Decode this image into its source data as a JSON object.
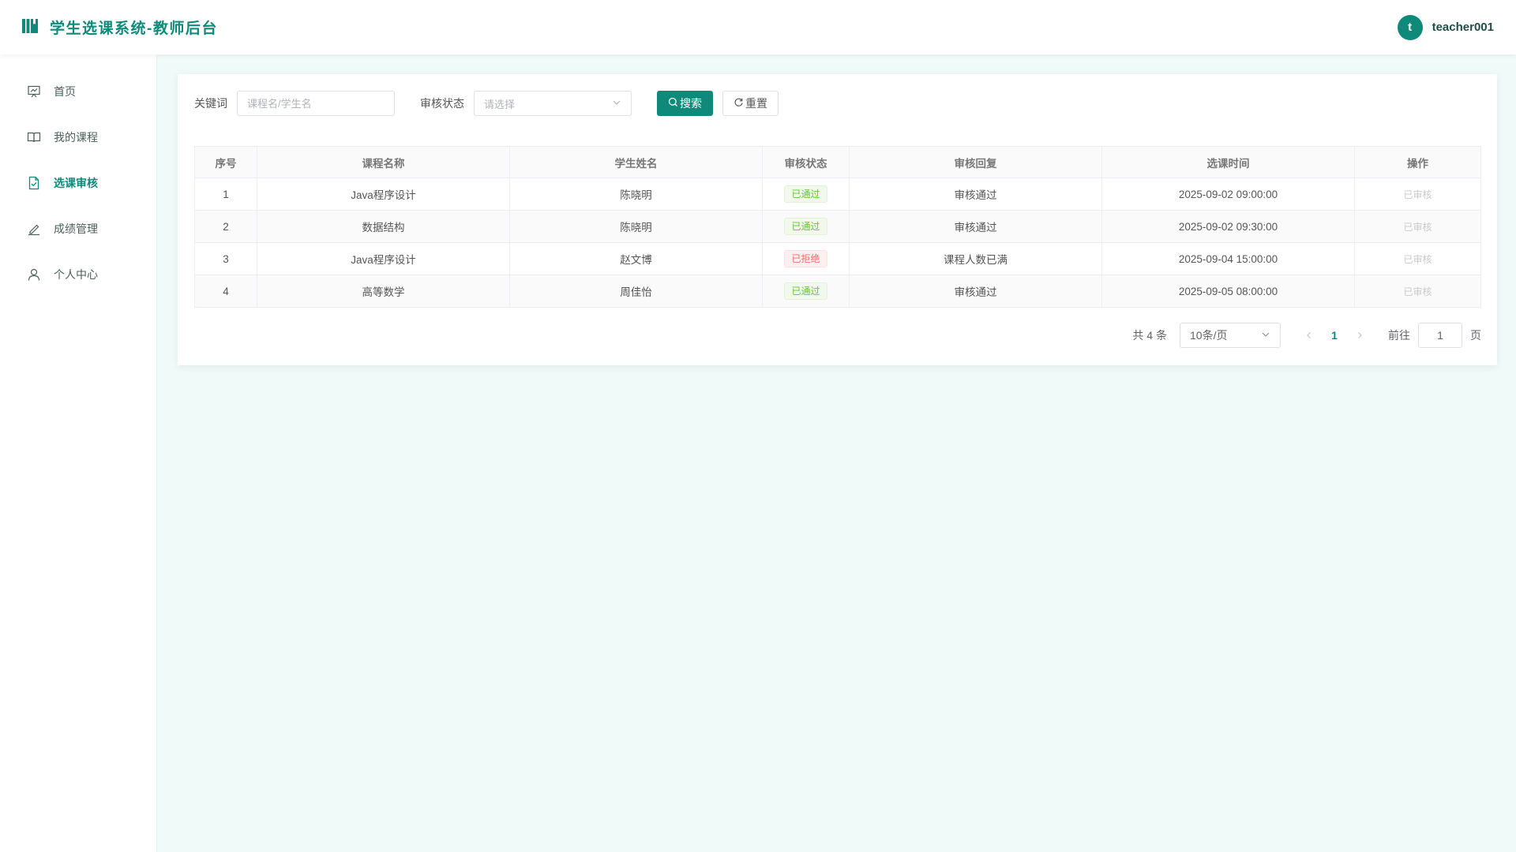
{
  "header": {
    "title": "学生选课系统-教师后台",
    "avatar_letter": "t",
    "username": "teacher001"
  },
  "colors": {
    "accent": "#0f8a7a",
    "success": "#67c23a",
    "danger": "#f56c6c"
  },
  "sidebar": {
    "items": [
      {
        "label": "首页",
        "icon": "presentation-board-icon",
        "active": false
      },
      {
        "label": "我的课程",
        "icon": "open-book-icon",
        "active": false
      },
      {
        "label": "选课审核",
        "icon": "document-check-icon",
        "active": true
      },
      {
        "label": "成绩管理",
        "icon": "edit-pen-icon",
        "active": false
      },
      {
        "label": "个人中心",
        "icon": "user-icon",
        "active": false
      }
    ]
  },
  "filters": {
    "keyword_label": "关键词",
    "keyword_placeholder": "课程名/学生名",
    "keyword_value": "",
    "status_label": "审核状态",
    "status_placeholder": "请选择",
    "search_label": "搜索",
    "reset_label": "重置"
  },
  "table": {
    "columns": [
      "序号",
      "课程名称",
      "学生姓名",
      "审核状态",
      "审核回复",
      "选课时间",
      "操作"
    ],
    "rows": [
      {
        "index": "1",
        "course": "Java程序设计",
        "student": "陈晓明",
        "status": "已通过",
        "status_type": "success",
        "reply": "审核通过",
        "time": "2025-09-02 09:00:00",
        "action": "已审核"
      },
      {
        "index": "2",
        "course": "数据结构",
        "student": "陈晓明",
        "status": "已通过",
        "status_type": "success",
        "reply": "审核通过",
        "time": "2025-09-02 09:30:00",
        "action": "已审核"
      },
      {
        "index": "3",
        "course": "Java程序设计",
        "student": "赵文博",
        "status": "已拒绝",
        "status_type": "danger",
        "reply": "课程人数已满",
        "time": "2025-09-04 15:00:00",
        "action": "已审核"
      },
      {
        "index": "4",
        "course": "高等数学",
        "student": "周佳怡",
        "status": "已通过",
        "status_type": "success",
        "reply": "审核通过",
        "time": "2025-09-05 08:00:00",
        "action": "已审核"
      }
    ]
  },
  "pagination": {
    "total_text": "共 4 条",
    "page_size": "10条/页",
    "current_page": "1",
    "goto_label": "前往",
    "goto_value": "1",
    "page_suffix": "页"
  }
}
